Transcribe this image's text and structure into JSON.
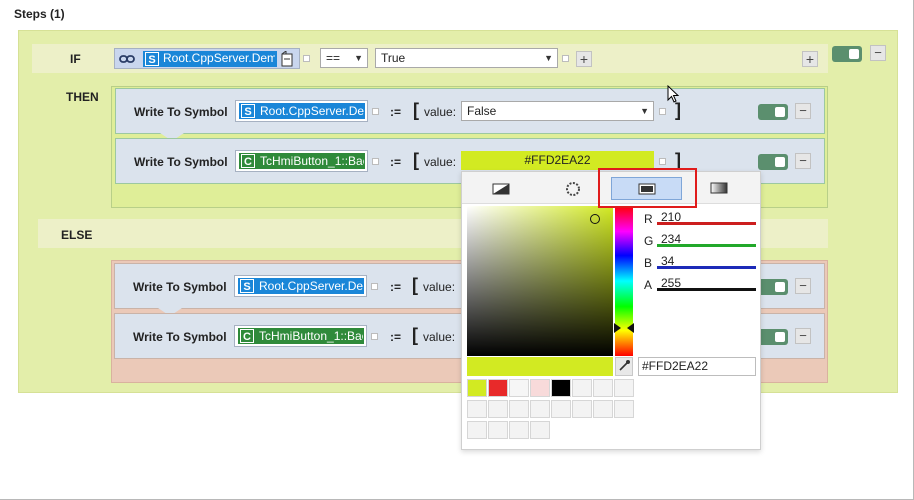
{
  "steps": {
    "title": "Steps (1)"
  },
  "if_row": {
    "label": "IF",
    "symbol_badge": "S",
    "symbol_text": "Root.CppServer.Demo",
    "operator": "==",
    "value": "True"
  },
  "then_label": "THEN",
  "else_label": "ELSE",
  "then_actions": [
    {
      "label": "Write To Symbol",
      "badge": "S",
      "symbol": "Root.CppServer.Der",
      "assign": ":=",
      "value_label": "value:",
      "value": "False"
    },
    {
      "label": "Write To Symbol",
      "badge": "C",
      "symbol": "TcHmiButton_1::Bac",
      "assign": ":=",
      "value_label": "value:",
      "value": "#FFD2EA22"
    }
  ],
  "else_actions": [
    {
      "label": "Write To Symbol",
      "badge": "S",
      "symbol": "Root.CppServer.Der",
      "assign": ":=",
      "value_label": "value:"
    },
    {
      "label": "Write To Symbol",
      "badge": "C",
      "symbol": "TcHmiButton_1::Bac",
      "assign": ":=",
      "value_label": "value:"
    }
  ],
  "color_picker": {
    "tabs": [
      "no-color",
      "radial-gradient",
      "solid-color",
      "linear-gradient"
    ],
    "active_tab": "solid-color",
    "channels": [
      {
        "name": "R",
        "value": "210"
      },
      {
        "name": "G",
        "value": "234"
      },
      {
        "name": "B",
        "value": "34"
      },
      {
        "name": "A",
        "value": "255"
      }
    ],
    "hex_value": "#FFD2EA22",
    "current_color": "#d2ea22",
    "swatch_colors": [
      "#d2ea22",
      "#e82a2a",
      "#f6f6f6",
      "#f8dada",
      "#000000",
      "#f3f3f3",
      "#f3f3f3",
      "#f3f3f3"
    ]
  },
  "colors": {
    "panel_bg": "#e3eeaa",
    "else_bg": "#ebc9b8",
    "toggle_on": "#5b8f6e",
    "symbol_blue": "#1a86d8",
    "symbol_green": "#2f8a3a",
    "highlight_red": "#e01b1b"
  }
}
